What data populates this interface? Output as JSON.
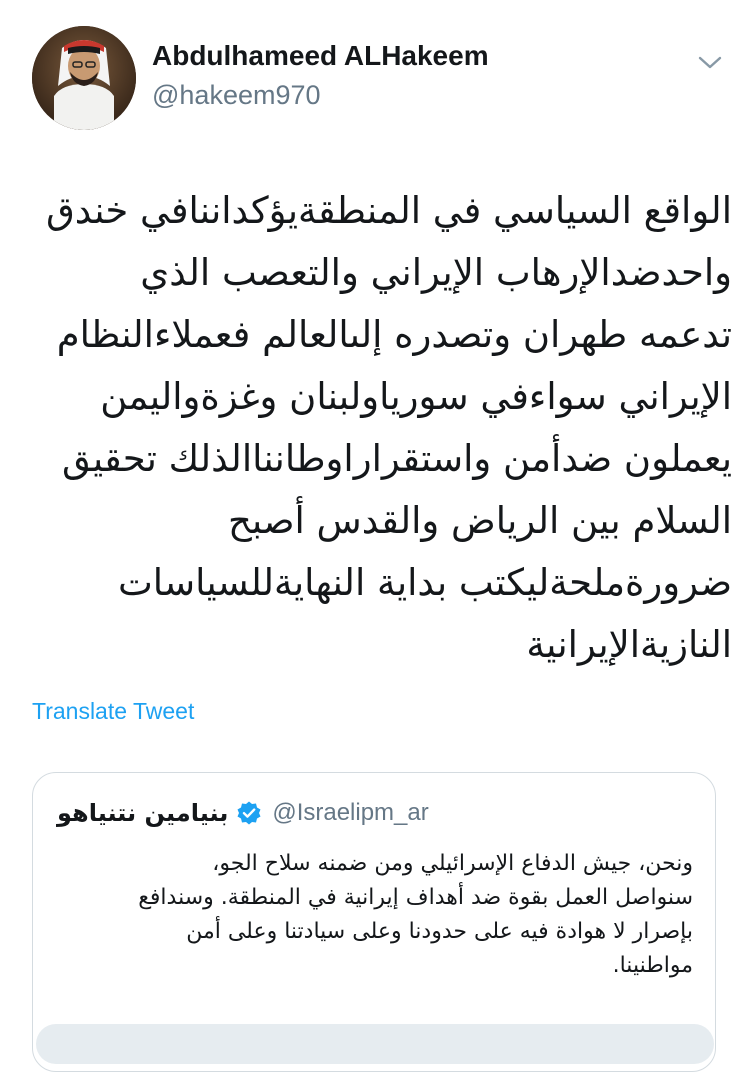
{
  "author": {
    "name": "Abdulhameed ALHakeem",
    "handle": "@hakeem970",
    "avatar_icon": "profile-photo"
  },
  "menu_icon": "chevron-down-icon",
  "tweet": {
    "lines": [
      "الواقع السياسي في المنطقةيؤكداننافي خندق",
      "واحدضدالإرهاب الإيراني والتعصب الذي",
      "تدعمه طهران وتصدره إلىالعالم فعملاءالنظام",
      "الإيراني سواءفي سورياولبنان وغزةواليمن",
      "يعملون ضدأمن واستقراراوطانناالذلك تحقيق",
      "السلام بين الرياض والقدس أصبح",
      "ضرورةملحةليكتب بداية النهايةللسياسات",
      "النازيةالإيرانية"
    ]
  },
  "translate_label": "Translate Tweet",
  "quoted_tweet": {
    "name": "بنيامين نتنياهو",
    "handle": "@Israelipm_ar",
    "verified": true,
    "lines": [
      "ونحن، جيش الدفاع الإسرائيلي ومن ضمنه سلاح الجو،",
      "سنواصل العمل بقوة ضد أهداف إيرانية في المنطقة. وسندافع",
      "بإصرار لا هوادة فيه على حدودنا وعلى سيادتنا وعلى أمن",
      "مواطنينا."
    ]
  },
  "colors": {
    "link": "#1da1f2",
    "secondary_text": "#657786",
    "primary_text": "#14171a",
    "border": "#d4dbe0"
  }
}
